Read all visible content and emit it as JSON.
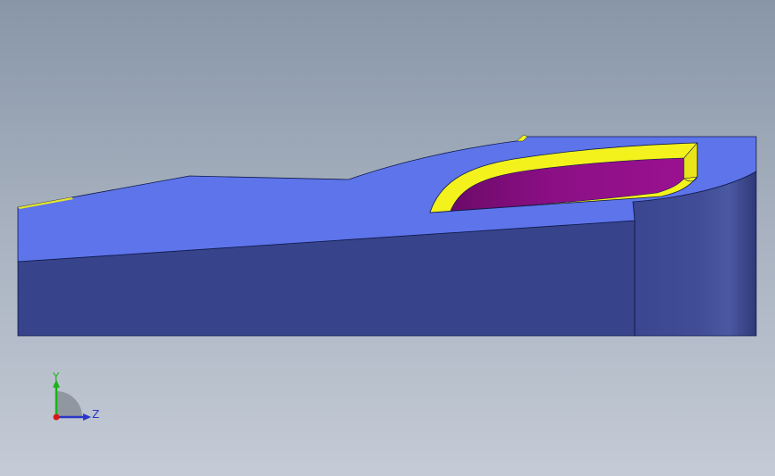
{
  "viewport": {
    "background_top": "#8896a8",
    "background_bottom": "#c4cbd6"
  },
  "model": {
    "top_face_color": "#5d74ea",
    "front_face_color": "#37448b",
    "side_face_color": "#3a4690",
    "fillet_color": "#f3f21c",
    "pocket_color": "#8a0d82",
    "edge_color": "#101a4a"
  },
  "triad": {
    "y_label": "Y",
    "z_label": "Z",
    "y_color": "#18b418",
    "z_color": "#2a37c8",
    "x_color": "#d81818"
  }
}
